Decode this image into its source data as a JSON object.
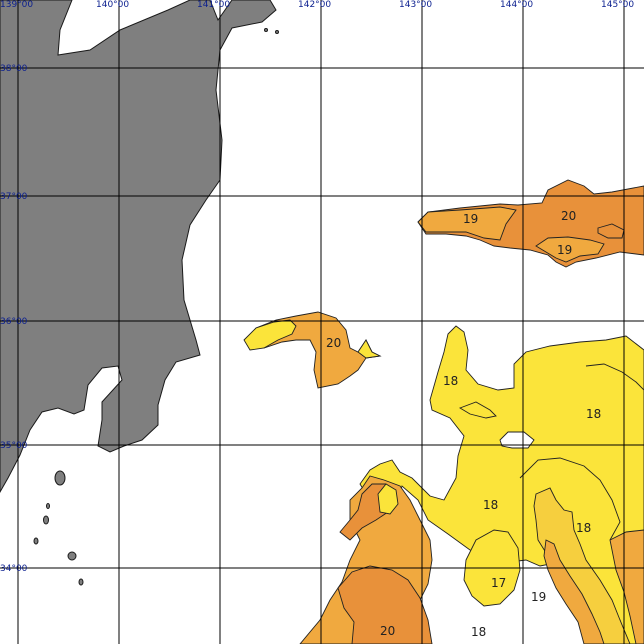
{
  "map": {
    "lon_labels": [
      "139°00",
      "140°00",
      "141°00",
      "142°00",
      "143°00",
      "144°00",
      "145°00"
    ],
    "lat_labels": [
      "38°00",
      "37°00",
      "36°00",
      "35°00",
      "34°00"
    ],
    "isotherm_labels": [
      "19",
      "20",
      "19",
      "20",
      "18",
      "18",
      "18",
      "18",
      "17",
      "19",
      "20",
      "18"
    ],
    "colors": {
      "land": "#7f7f7f",
      "water": "#ffffff",
      "grid": "#000000",
      "label_blue": "#0b1f8f",
      "sst_yellow": "#fbe43a",
      "sst_light_orange": "#f6cf3e",
      "sst_orange": "#f0a93f",
      "sst_dark_orange": "#e8913a"
    }
  }
}
